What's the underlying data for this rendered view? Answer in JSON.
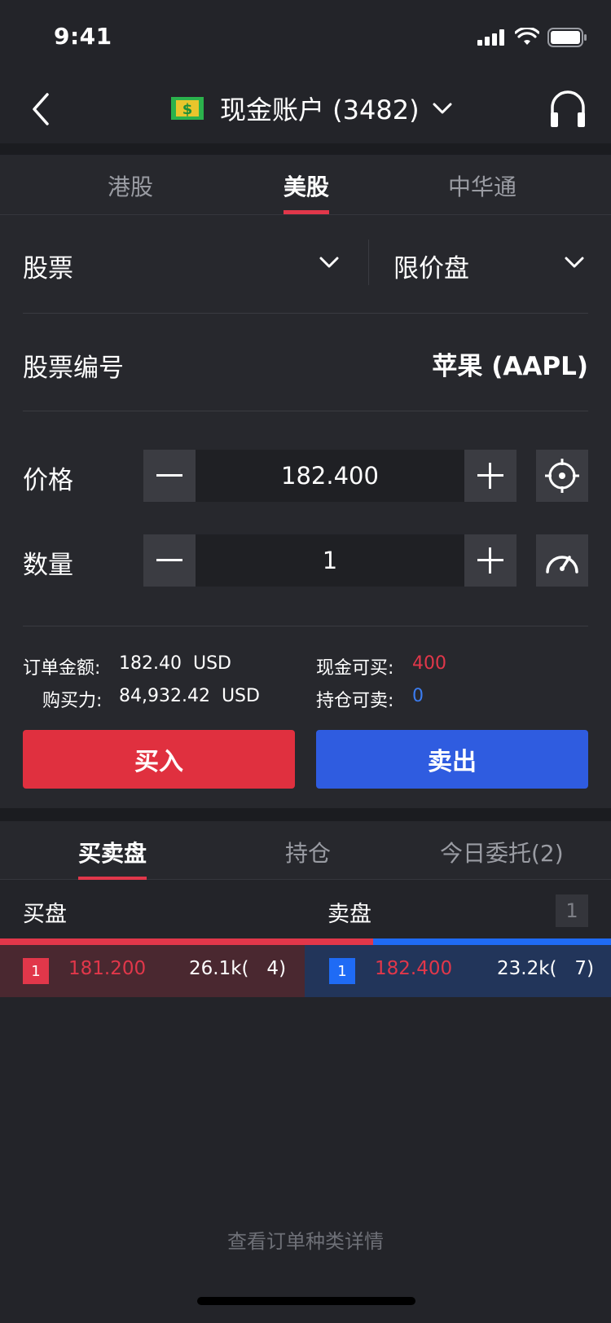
{
  "status_bar": {
    "time": "9:41"
  },
  "header": {
    "account_title": "现金账户 (3482)",
    "account_icon": "dollar-bill-icon"
  },
  "market_tabs": [
    {
      "label": "港股",
      "active": false
    },
    {
      "label": "美股",
      "active": true
    },
    {
      "label": "中华通",
      "active": false
    }
  ],
  "order": {
    "type_select": "股票",
    "price_type_select": "限价盘",
    "stock_label": "股票编号",
    "stock_value": "苹果 (AAPL)",
    "price_label": "价格",
    "price_value": "182.400",
    "qty_label": "数量",
    "qty_value": "1"
  },
  "summary": {
    "order_amount_label": "订单金额:",
    "order_amount_value": "182.40  USD",
    "buying_power_label": "购买力:",
    "buying_power_value": "84,932.42  USD",
    "cash_buy_label": "现金可买:",
    "cash_buy_value": "400",
    "hold_sell_label": "持仓可卖:",
    "hold_sell_value": "0"
  },
  "actions": {
    "buy_label": "买入",
    "sell_label": "卖出"
  },
  "book_tabs": [
    {
      "label": "买卖盘",
      "active": true
    },
    {
      "label": "持仓",
      "active": false
    },
    {
      "label": "今日委托(2)",
      "active": false
    }
  ],
  "order_book": {
    "bid_header": "买盘",
    "ask_header": "卖盘",
    "depth": "1",
    "bid": {
      "level": "1",
      "price": "181.200",
      "volume": "26.1k(   4)"
    },
    "ask": {
      "level": "1",
      "price": "182.400",
      "volume": "23.2k(   7)"
    }
  },
  "footer": {
    "link": "查看订单种类详情"
  },
  "colors": {
    "accent_red": "#e1374a",
    "accent_blue": "#2f5ce0",
    "background": "#232429"
  }
}
